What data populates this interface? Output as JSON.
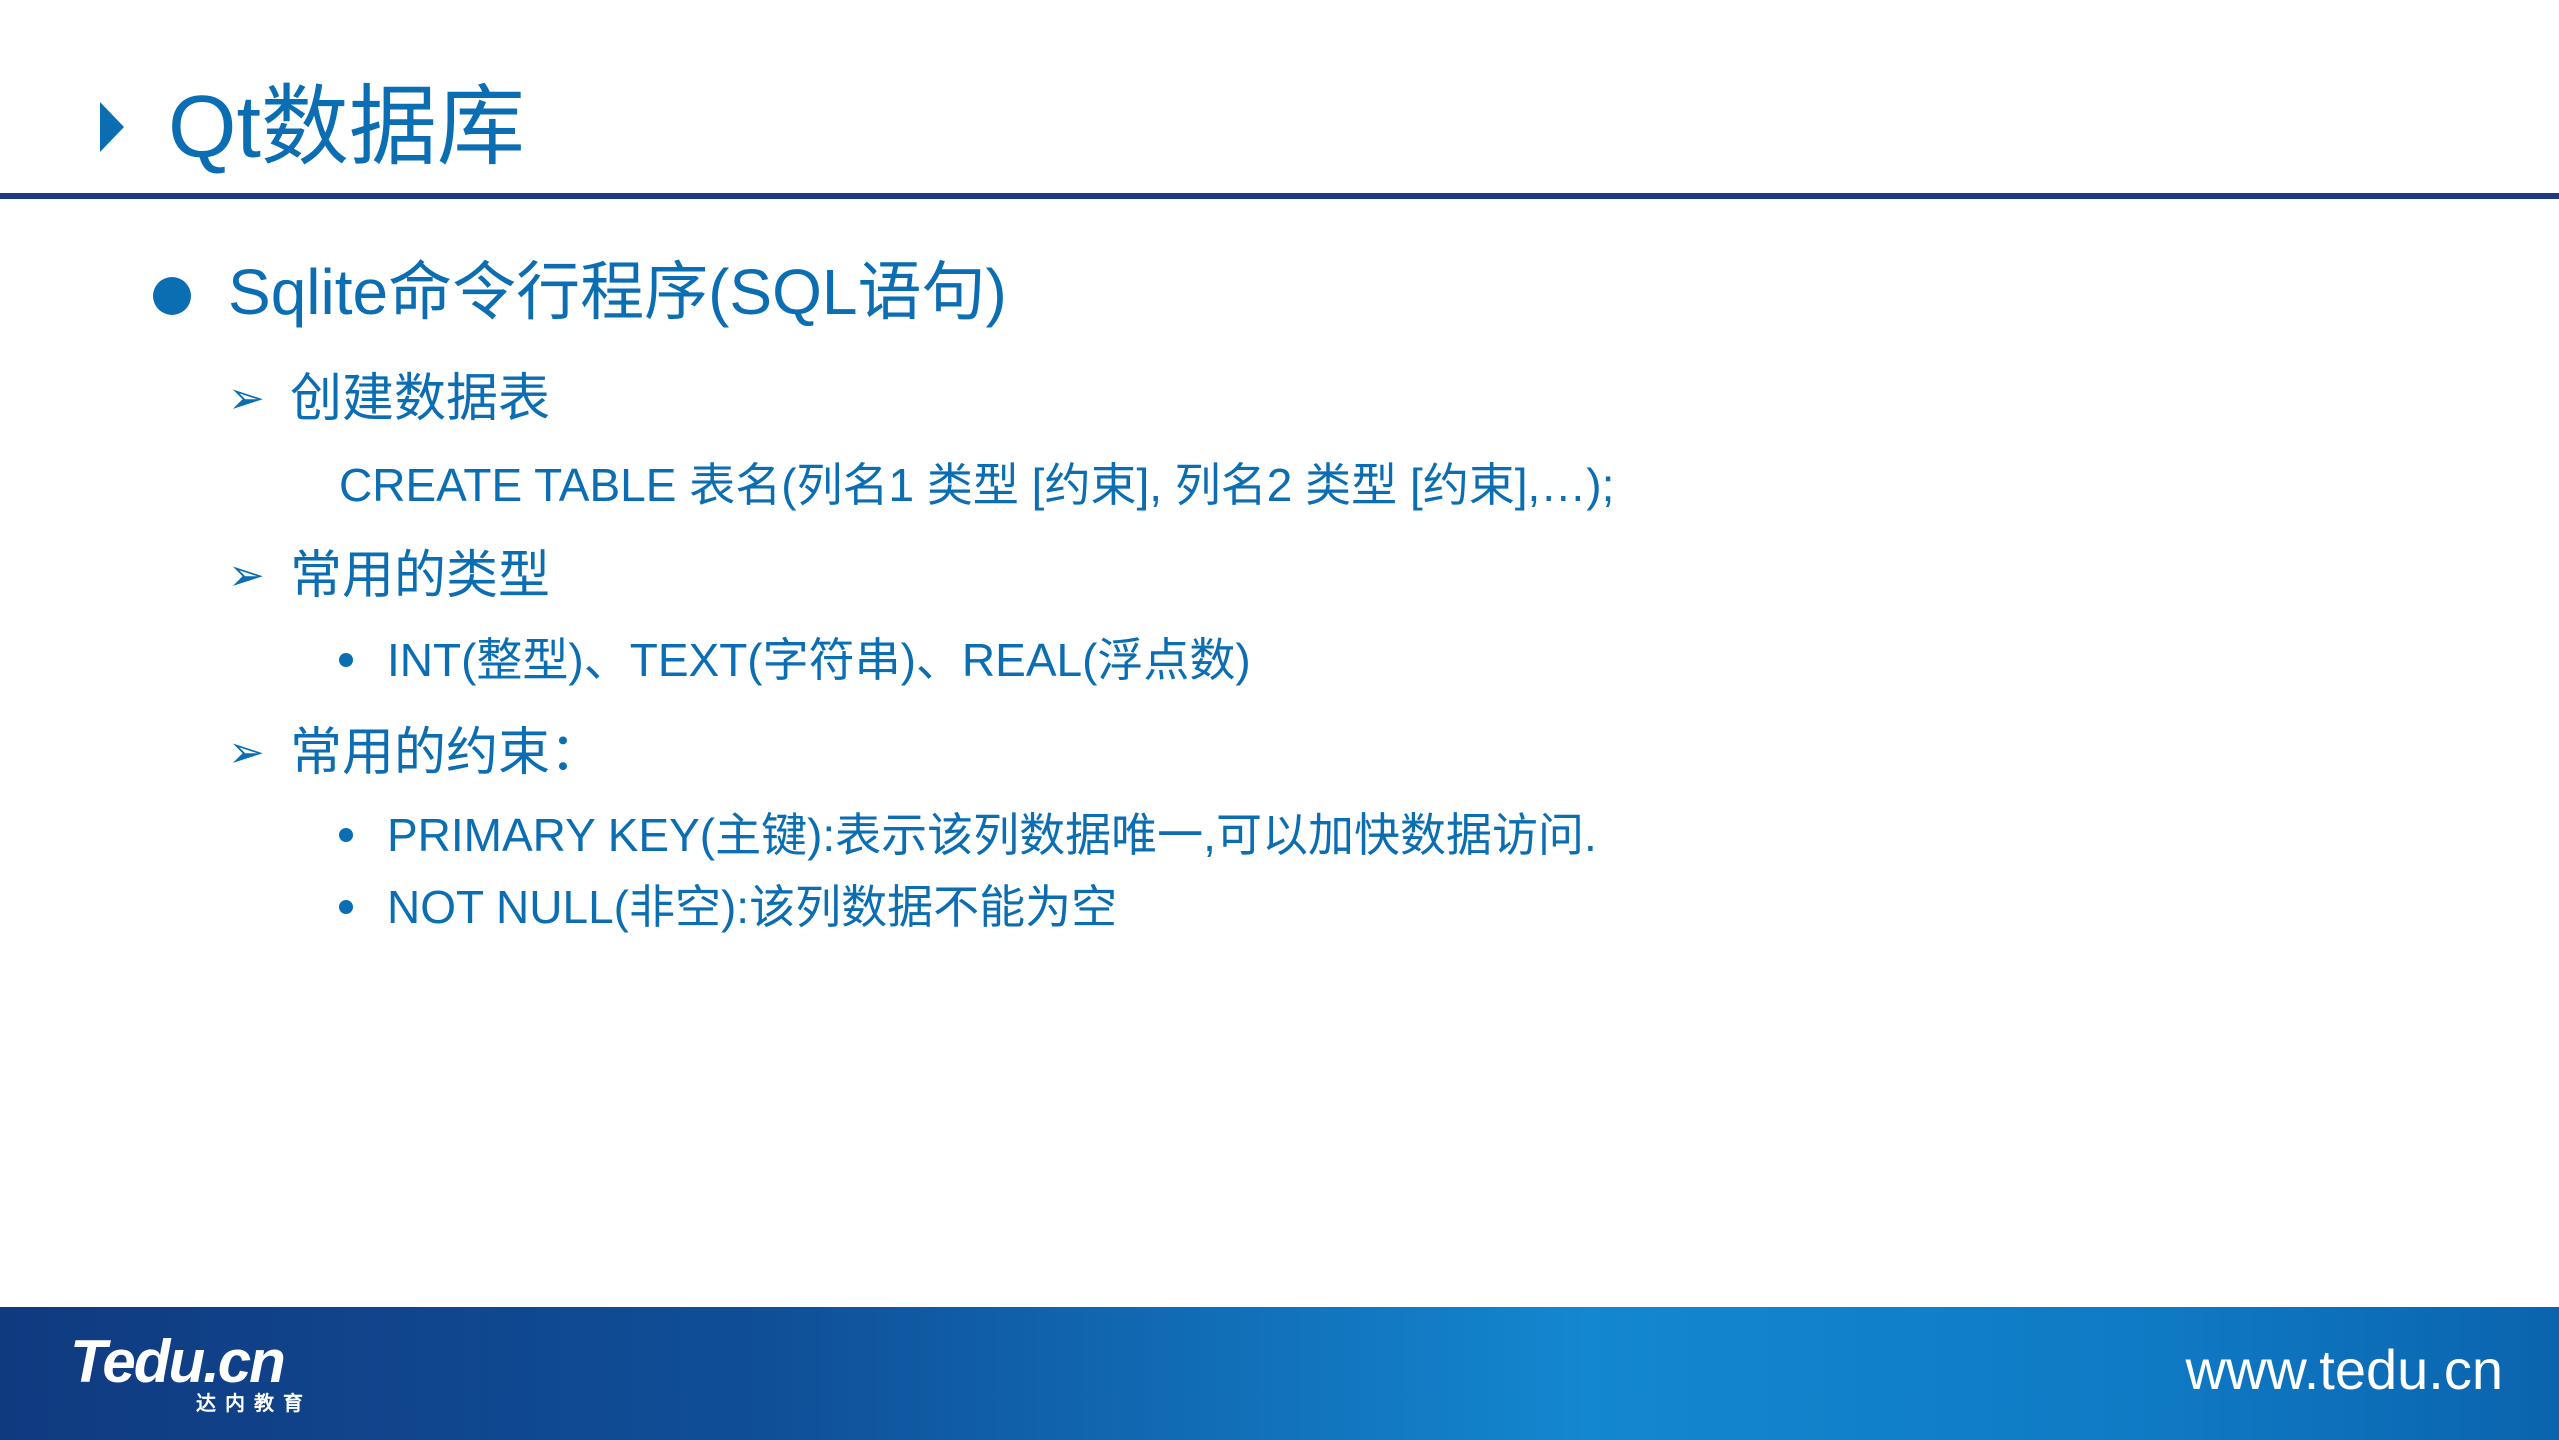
{
  "slide": {
    "title": "Qt数据库",
    "heading": "Sqlite命令行程序(SQL语句)",
    "sections": [
      {
        "label": "创建数据表",
        "body": "CREATE TABLE 表名(列名1 类型 [约束], 列名2 类型 [约束],…);"
      },
      {
        "label": "常用的类型",
        "items": [
          "INT(整型)、TEXT(字符串)、REAL(浮点数)"
        ]
      },
      {
        "label": "常用的约束：",
        "items": [
          "PRIMARY KEY(主键):表示该列数据唯一,可以加快数据访问.",
          "NOT NULL(非空):该列数据不能为空"
        ]
      }
    ]
  },
  "footer": {
    "logo_text": "Tedu.cn",
    "logo_subtext": "达内教育",
    "url": "www.tedu.cn"
  },
  "colors": {
    "accent": "#0b6db2",
    "rule": "#1d3b82",
    "footer_start": "#103a80",
    "footer_end": "#0b63ad"
  },
  "icons": {
    "title_marker": "triangle-right-icon",
    "heading_marker": "filled-circle-bullet-icon",
    "section_marker": "arrowhead-bullet-icon",
    "item_marker": "small-dot-bullet-icon"
  }
}
